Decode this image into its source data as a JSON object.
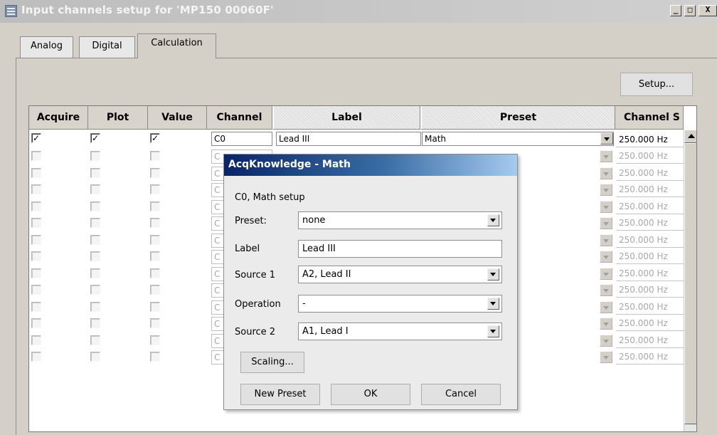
{
  "window": {
    "title": "Input channels setup for 'MP150 00060F'",
    "controls": {
      "minimize": "_",
      "maximize": "□",
      "close": "X"
    }
  },
  "tabs": [
    {
      "label": "Analog",
      "active": false
    },
    {
      "label": "Digital",
      "active": false
    },
    {
      "label": "Calculation",
      "active": true
    }
  ],
  "setup_button": "Setup...",
  "grid": {
    "headers": {
      "acquire": "Acquire",
      "plot": "Plot",
      "value": "Value",
      "channel": "Channel",
      "label": "Label",
      "preset": "Preset",
      "rate": "Channel S"
    },
    "first_row": {
      "acquire": true,
      "plot": true,
      "value": true,
      "channel": "C0",
      "label": "Lead III",
      "preset": "Math",
      "rate": "250.000 Hz"
    },
    "rows": [
      {
        "channel": "C",
        "rate": "250.000 Hz"
      },
      {
        "channel": "C",
        "rate": "250.000 Hz"
      },
      {
        "channel": "C",
        "rate": "250.000 Hz"
      },
      {
        "channel": "C",
        "rate": "250.000 Hz"
      },
      {
        "channel": "C",
        "rate": "250.000 Hz"
      },
      {
        "channel": "C",
        "rate": "250.000 Hz"
      },
      {
        "channel": "C",
        "rate": "250.000 Hz"
      },
      {
        "channel": "C",
        "rate": "250.000 Hz"
      },
      {
        "channel": "C",
        "rate": "250.000 Hz"
      },
      {
        "channel": "C",
        "rate": "250.000 Hz"
      },
      {
        "channel": "C",
        "rate": "250.000 Hz"
      },
      {
        "channel": "C",
        "rate": "250.000 Hz"
      },
      {
        "channel": "C",
        "rate": "250.000 Hz"
      }
    ]
  },
  "math_dialog": {
    "title": "AcqKnowledge - Math",
    "subtitle": "C0, Math setup",
    "preset_label": "Preset:",
    "preset_value": "none",
    "label_label": "Label",
    "label_value": "Lead III",
    "source1_label": "Source 1",
    "source1_value": "A2, Lead II",
    "operation_label": "Operation",
    "operation_value": "-",
    "source2_label": "Source 2",
    "source2_value": "A1, Lead I",
    "scaling_button": "Scaling...",
    "new_preset_button": "New Preset",
    "ok_button": "OK",
    "cancel_button": "Cancel"
  }
}
